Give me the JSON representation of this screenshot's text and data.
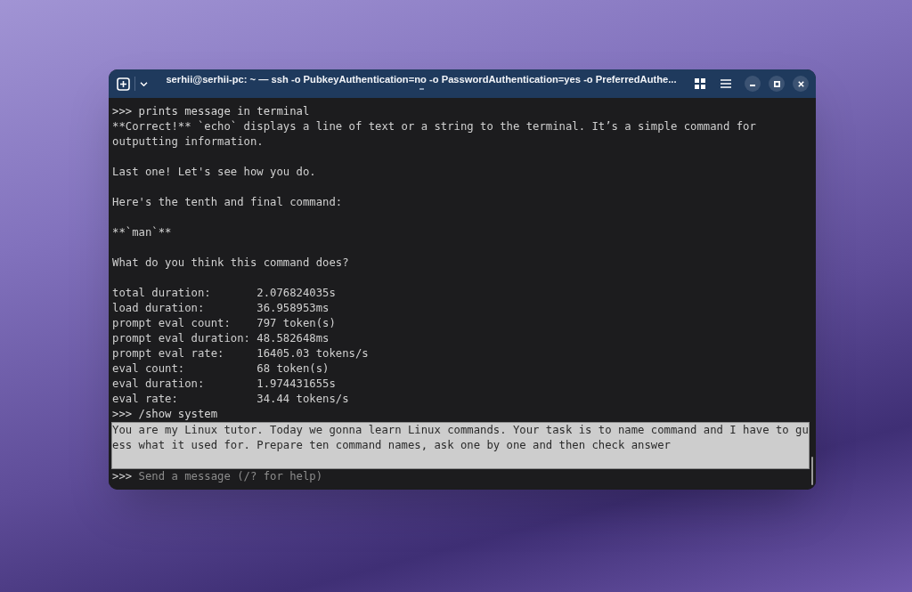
{
  "window": {
    "title": "serhii@serhii-pc: ~ — ssh -o PubkeyAuthentication=no -o PasswordAuthentication=yes -o PreferredAuthe..."
  },
  "terminal": {
    "lines": [
      {
        "kind": "input",
        "text": ">>> prints message in terminal"
      },
      {
        "kind": "output",
        "text": "**Correct!** `echo` displays a line of text or a string to the terminal. It’s a simple command for"
      },
      {
        "kind": "output",
        "text": "outputting information."
      },
      {
        "kind": "blank"
      },
      {
        "kind": "output",
        "text": "Last one! Let's see how you do."
      },
      {
        "kind": "blank"
      },
      {
        "kind": "output",
        "text": "Here's the tenth and final command:"
      },
      {
        "kind": "blank"
      },
      {
        "kind": "output",
        "text": "**`man`**"
      },
      {
        "kind": "blank"
      },
      {
        "kind": "output",
        "text": "What do you think this command does?"
      },
      {
        "kind": "blank"
      },
      {
        "kind": "stat",
        "label": "total duration:",
        "value": "2.076824035s"
      },
      {
        "kind": "stat",
        "label": "load duration:",
        "value": "36.958953ms"
      },
      {
        "kind": "stat",
        "label": "prompt eval count:",
        "value": "797 token(s)"
      },
      {
        "kind": "stat",
        "label": "prompt eval duration:",
        "value": "48.582648ms"
      },
      {
        "kind": "stat",
        "label": "prompt eval rate:",
        "value": "16405.03 tokens/s"
      },
      {
        "kind": "stat",
        "label": "eval count:",
        "value": "68 token(s)"
      },
      {
        "kind": "stat",
        "label": "eval duration:",
        "value": "1.974431655s"
      },
      {
        "kind": "stat",
        "label": "eval rate:",
        "value": "34.44 tokens/s"
      },
      {
        "kind": "input",
        "text": ">>> /show system"
      },
      {
        "kind": "system",
        "highlighted": true,
        "text": "You are my Linux tutor. Today we gonna learn Linux commands. Your task is to name command and I have to guess what it used for. Prepare ten command names, ask one by one and then check answer"
      }
    ],
    "input_line": {
      "prompt": ">>>",
      "placeholder": "Send a message (/? for help)"
    }
  }
}
